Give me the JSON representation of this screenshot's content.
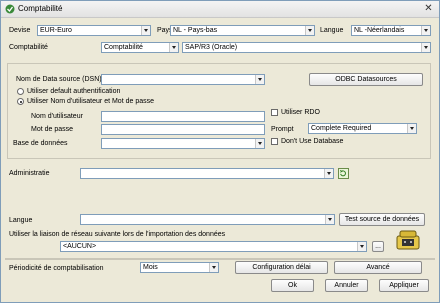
{
  "window": {
    "title": "Comptabilité"
  },
  "row1": {
    "devise_label": "Devise",
    "devise_value": "EUR-Euro",
    "pays_label": "Pays",
    "pays_value": "NL - Pays-bas",
    "langue_label": "Langue",
    "langue_value": "NL -Néerlandais"
  },
  "row2": {
    "comptabilite_label": "Comptabilité",
    "type_value": "Comptabilité",
    "system_value": "SAP/R3 (Oracle)"
  },
  "dsn": {
    "label": "Nom de Data source (DSN)",
    "value": "",
    "odbc_button": "ODBC Datasources"
  },
  "auth": {
    "option_default": "Utiliser default authentification",
    "option_user": "Utiliser Nom d'utilisateur et Mot de passe",
    "user_label": "Nom d'utilisateur",
    "password_label": "Mot de passe",
    "rdo_label": "Utiliser RDO",
    "prompt_label": "Prompt",
    "prompt_value": "Complete Required",
    "dont_use_db_label": "Don't Use Database",
    "database_label": "Base de données"
  },
  "administratie": {
    "label": "Administratie",
    "value": ""
  },
  "langue2": {
    "label": "Langue",
    "value": "",
    "test_button": "Test source de données"
  },
  "network": {
    "label": "Utiliser la liaison de réseau suivante lors de l'importation des données",
    "value": "<AUCUN>",
    "browse_button": "..."
  },
  "periodicity": {
    "label": "Périodicité de comptabilisation",
    "value": "Mois",
    "config_button": "Configuration délai",
    "advanced_button": "Avancé"
  },
  "footer": {
    "ok": "Ok",
    "cancel": "Annuler",
    "apply": "Appliquer"
  }
}
